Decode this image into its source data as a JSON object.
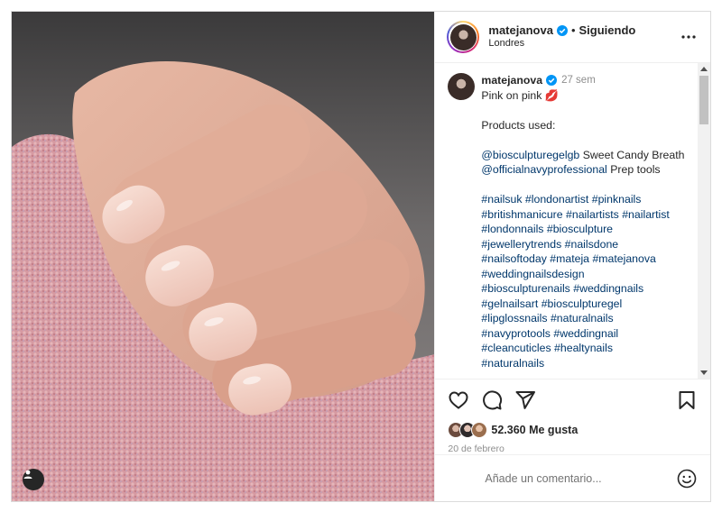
{
  "header": {
    "username": "matejanova",
    "separator": "•",
    "follow_label": "Siguiendo",
    "location": "Londres"
  },
  "caption": {
    "username": "matejanova",
    "time_ago": "27 sem",
    "title": "Pink on pink 💋",
    "products_label": "Products used:",
    "product_lines": [
      {
        "mention": "@biosculpturegelgb",
        "text": " Sweet Candy Breath"
      },
      {
        "mention": "@officialnavyprofessional",
        "text": " Prep tools"
      }
    ],
    "hashtag_lines": [
      "#nailsuk #londonartist #pinknails",
      "#britishmanicure #nailartists #nailartist",
      "#londonnails #biosculpture",
      "#jewellerytrends #nailsdone",
      "#nailsoftoday #mateja #matejanova",
      "#weddingnailsdesign",
      "#biosculpturenails #weddingnails",
      "#gelnailsart #biosculpturegel",
      "#lipglossnails #naturalnails",
      "#navyprotools #weddingnail",
      "#cleancuticles #healtynails",
      "#naturalnails"
    ]
  },
  "likes": {
    "count_label": "52.360 Me gusta"
  },
  "date": "20 de febrero",
  "comment": {
    "placeholder": "Añade un comentario..."
  },
  "colors": {
    "link": "#00376b",
    "verified": "#0095f6",
    "muted": "#8e8e8e",
    "nail": "#f2cfc4",
    "sweater": "#d59aa0"
  },
  "icons": [
    "user-tag-icon",
    "verified-icon",
    "more-options-icon",
    "heart-icon",
    "comment-icon",
    "share-icon",
    "bookmark-icon",
    "emoji-icon"
  ]
}
